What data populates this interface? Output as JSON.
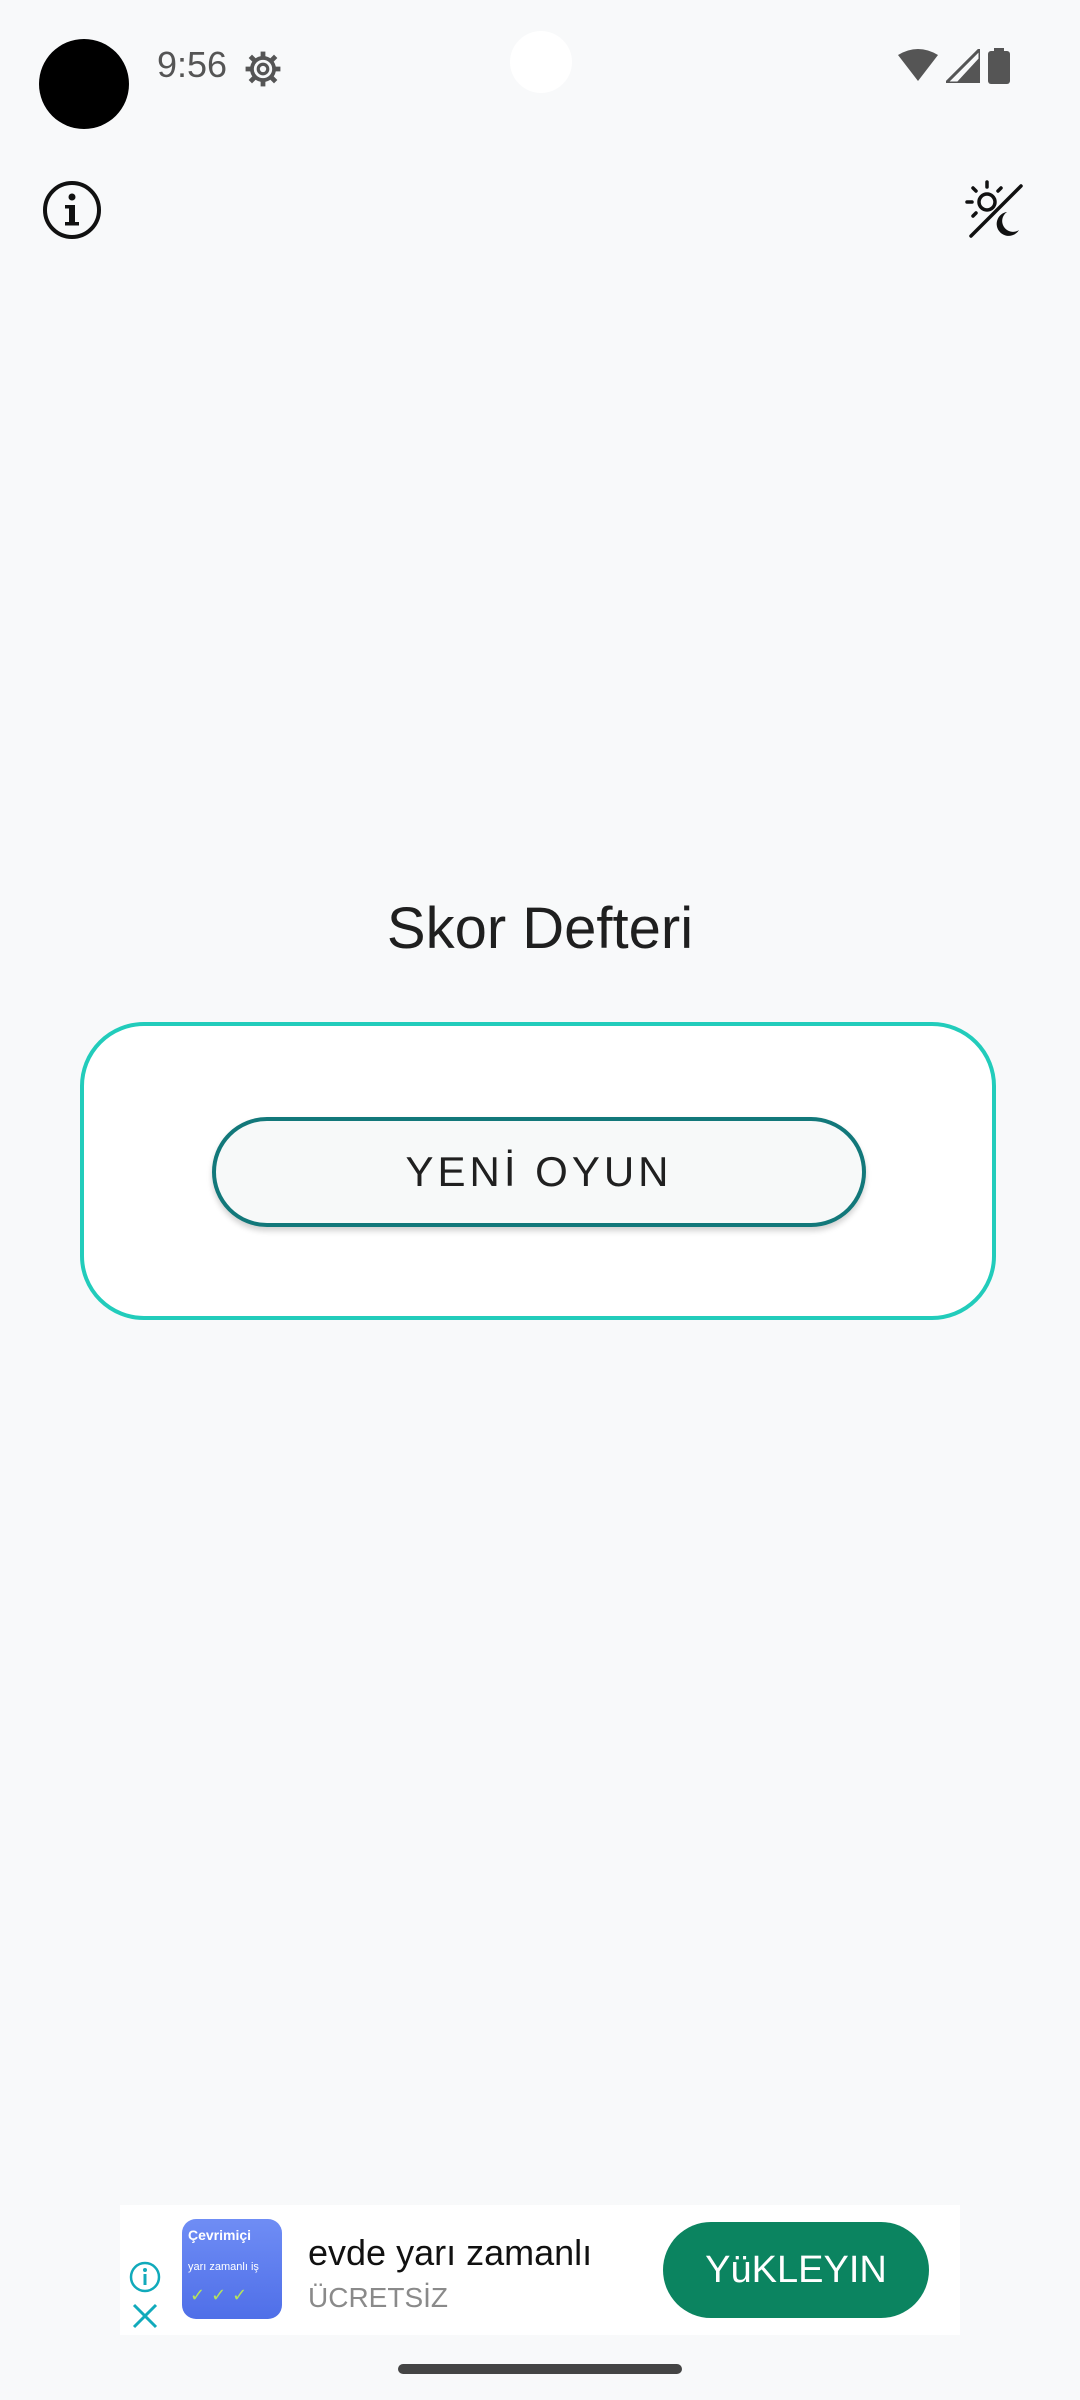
{
  "status_bar": {
    "time": "9:56",
    "icons": [
      "settings-gear-icon",
      "wifi-icon",
      "cell-signal-icon",
      "battery-icon"
    ]
  },
  "toolbar": {
    "info_icon": "info-icon",
    "theme_icon": "theme-toggle-icon"
  },
  "main": {
    "title": "Skor Defteri",
    "new_game_label": "YENİ OYUN"
  },
  "ad": {
    "app_icon_text1": "Çevrimiçi",
    "app_icon_text2": "yarı zamanlı iş",
    "title": "evde yarı zamanlı",
    "subtitle": "ÜCRETSİZ",
    "install_label": "YüKLEYIN"
  },
  "colors": {
    "card_border": "#22ccbb",
    "button_border": "#12787a",
    "ad_button": "#0b8460",
    "background": "#f8f9fa"
  }
}
